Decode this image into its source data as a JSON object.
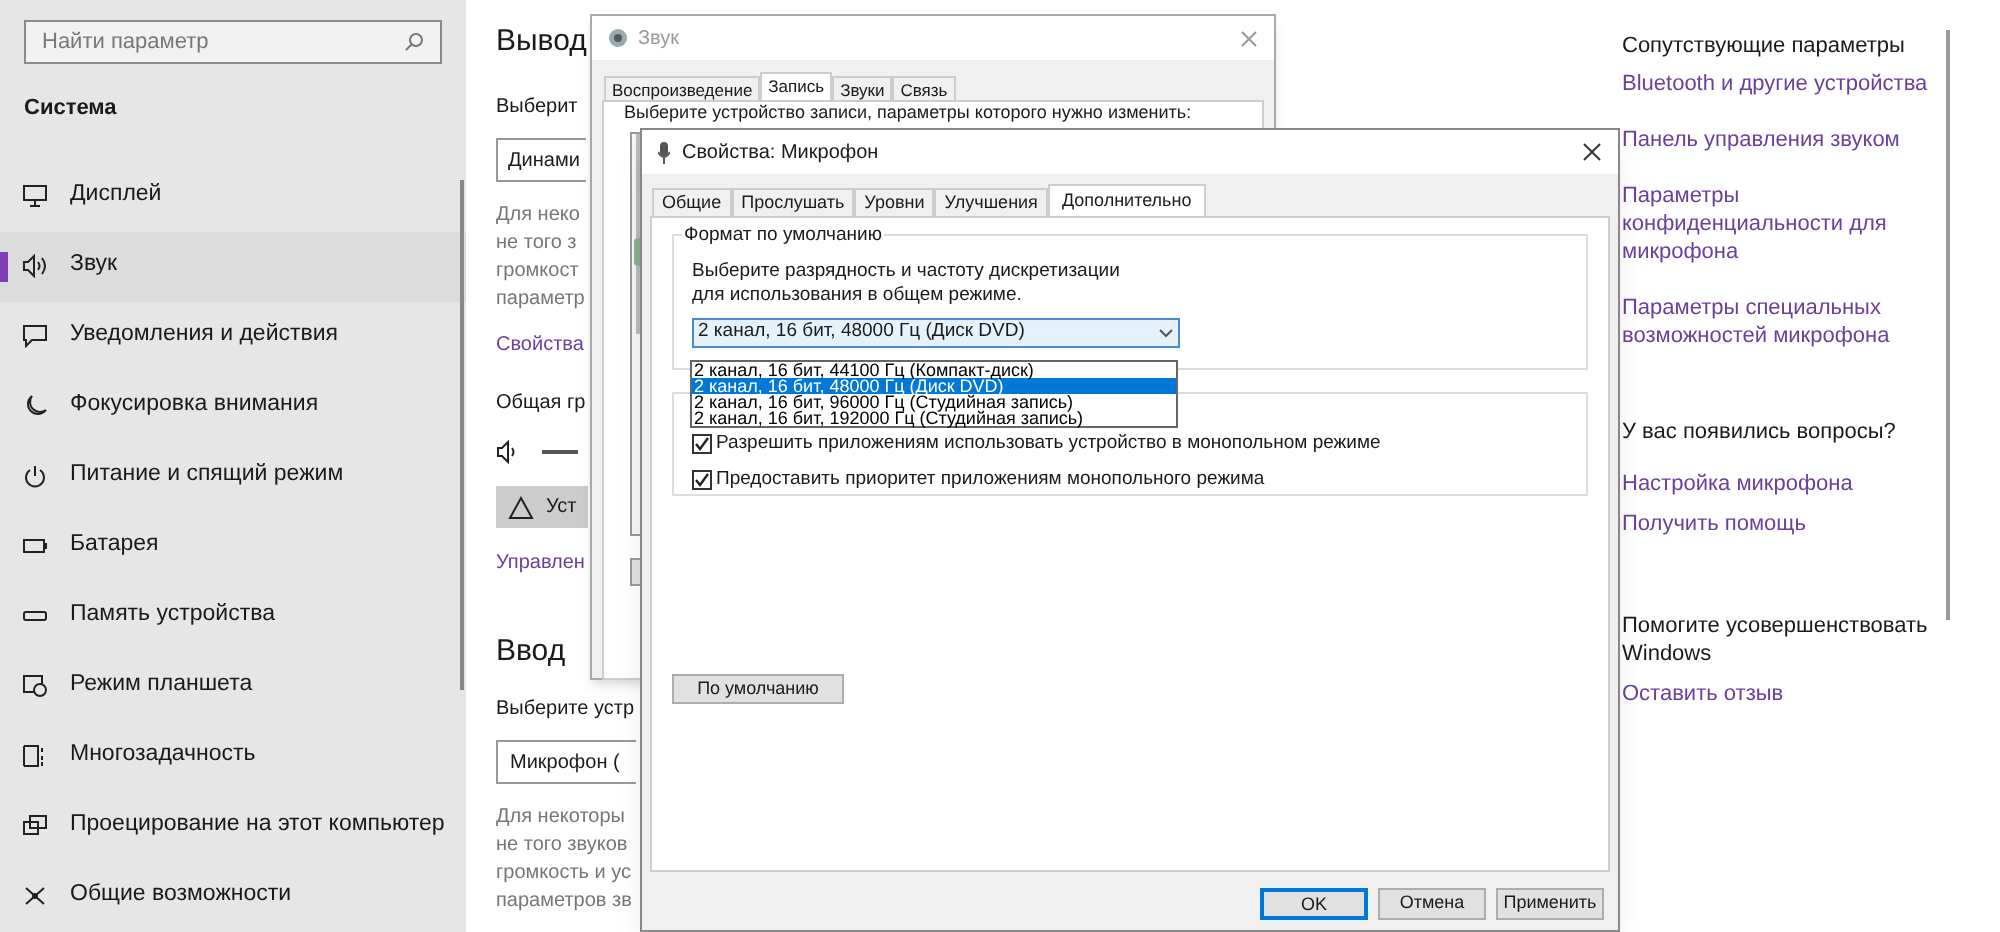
{
  "settings": {
    "search": {
      "placeholder": "Найти параметр"
    },
    "section": "Система",
    "nav": [
      {
        "label": "Дисплей",
        "selected": false
      },
      {
        "label": "Звук",
        "selected": true
      },
      {
        "label": "Уведомления и действия",
        "selected": false
      },
      {
        "label": "Фокусировка внимания",
        "selected": false
      },
      {
        "label": "Питание и спящий режим",
        "selected": false
      },
      {
        "label": "Батарея",
        "selected": false
      },
      {
        "label": "Память устройства",
        "selected": false
      },
      {
        "label": "Режим планшета",
        "selected": false
      },
      {
        "label": "Многозадачность",
        "selected": false
      },
      {
        "label": "Проецирование на этот компьютер",
        "selected": false
      },
      {
        "label": "Общие возможности",
        "selected": false
      }
    ],
    "content": {
      "output_heading": "Вывод",
      "output_prompt": "Выберит",
      "output_device": "Динами",
      "output_note": [
        "Для неко",
        "не того з",
        "громкост",
        "параметр"
      ],
      "properties_link": "Свойства",
      "volume_label": "Общая гр",
      "troubleshoot_button": "Уст",
      "manage_link": "Управлен",
      "input_heading": "Ввод",
      "input_prompt": "Выберите устр",
      "input_device": "Микрофон (",
      "input_note": [
        "Для некоторы",
        "не того звуков",
        "громкость и ус",
        "параметров зв"
      ]
    },
    "related": [
      {
        "kind": "heading",
        "text": "Сопутствующие параметры"
      },
      {
        "kind": "link",
        "text": "Bluetooth и другие устройства"
      },
      {
        "kind": "link",
        "text": "Панель управления звуком"
      },
      {
        "kind": "link",
        "text": "Параметры конфиденциальности для микрофона"
      },
      {
        "kind": "link",
        "text": "Параметры специальных возможностей микрофона"
      },
      {
        "kind": "heading",
        "text": "У вас появились вопросы?"
      },
      {
        "kind": "link",
        "text": "Настройка микрофона"
      },
      {
        "kind": "link",
        "text": "Получить помощь"
      },
      {
        "kind": "heading",
        "text": "Помогите усовершенствовать Windows"
      },
      {
        "kind": "link",
        "text": "Оставить отзыв"
      }
    ]
  },
  "sound_window": {
    "title": "Звук",
    "tabs": [
      {
        "label": "Воспроизведение",
        "selected": false
      },
      {
        "label": "Запись",
        "selected": true
      },
      {
        "label": "Звуки",
        "selected": false
      },
      {
        "label": "Связь",
        "selected": false
      }
    ],
    "prompt": "Выберите устройство записи, параметры которого нужно изменить:"
  },
  "properties_dialog": {
    "title": "Свойства: Микрофон",
    "tabs": [
      {
        "label": "Общие",
        "selected": false
      },
      {
        "label": "Прослушать",
        "selected": false
      },
      {
        "label": "Уровни",
        "selected": false
      },
      {
        "label": "Улучшения",
        "selected": false
      },
      {
        "label": "Дополнительно",
        "selected": true
      }
    ],
    "format_group": {
      "title": "Формат по умолчанию",
      "description": "Выберите разрядность и частоту дискретизации для использования в общем режиме.",
      "value": "2 канал, 16 бит, 48000 Гц (Диск DVD)",
      "options": [
        {
          "label": "2 канал, 16 бит, 44100 Гц (Компакт-диск)",
          "selected": false
        },
        {
          "label": "2 канал, 16 бит, 48000 Гц (Диск DVD)",
          "selected": true
        },
        {
          "label": "2 канал, 16 бит, 96000 Гц (Студийная запись)",
          "selected": false
        },
        {
          "label": "2 канал, 16 бит, 192000 Гц (Студийная запись)",
          "selected": false
        }
      ]
    },
    "exclusive_options": [
      {
        "label": "Разрешить приложениям использовать устройство в монопольном режиме",
        "checked": true
      },
      {
        "label": "Предоставить приоритет приложениям монопольного режима",
        "checked": true
      }
    ],
    "default_button": "По умолчанию",
    "buttons": [
      {
        "label": "OK",
        "kind": "default"
      },
      {
        "label": "Отмена",
        "kind": "normal"
      },
      {
        "label": "Применить",
        "kind": "normal"
      }
    ]
  }
}
